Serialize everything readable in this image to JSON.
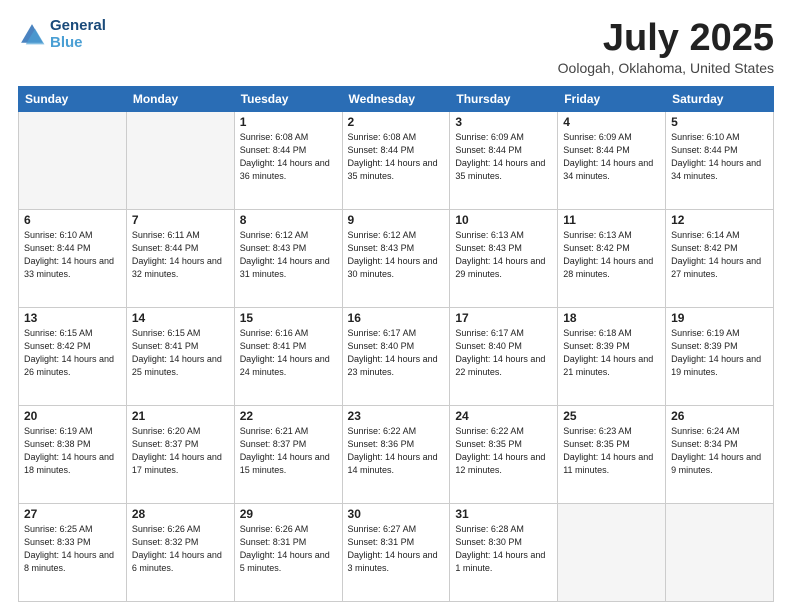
{
  "logo": {
    "line1": "General",
    "line2": "Blue"
  },
  "title": "July 2025",
  "subtitle": "Oologah, Oklahoma, United States",
  "days_of_week": [
    "Sunday",
    "Monday",
    "Tuesday",
    "Wednesday",
    "Thursday",
    "Friday",
    "Saturday"
  ],
  "weeks": [
    [
      {
        "day": "",
        "empty": true
      },
      {
        "day": "",
        "empty": true
      },
      {
        "day": "1",
        "sunrise": "6:08 AM",
        "sunset": "8:44 PM",
        "daylight": "14 hours and 36 minutes."
      },
      {
        "day": "2",
        "sunrise": "6:08 AM",
        "sunset": "8:44 PM",
        "daylight": "14 hours and 35 minutes."
      },
      {
        "day": "3",
        "sunrise": "6:09 AM",
        "sunset": "8:44 PM",
        "daylight": "14 hours and 35 minutes."
      },
      {
        "day": "4",
        "sunrise": "6:09 AM",
        "sunset": "8:44 PM",
        "daylight": "14 hours and 34 minutes."
      },
      {
        "day": "5",
        "sunrise": "6:10 AM",
        "sunset": "8:44 PM",
        "daylight": "14 hours and 34 minutes."
      }
    ],
    [
      {
        "day": "6",
        "sunrise": "6:10 AM",
        "sunset": "8:44 PM",
        "daylight": "14 hours and 33 minutes."
      },
      {
        "day": "7",
        "sunrise": "6:11 AM",
        "sunset": "8:44 PM",
        "daylight": "14 hours and 32 minutes."
      },
      {
        "day": "8",
        "sunrise": "6:12 AM",
        "sunset": "8:43 PM",
        "daylight": "14 hours and 31 minutes."
      },
      {
        "day": "9",
        "sunrise": "6:12 AM",
        "sunset": "8:43 PM",
        "daylight": "14 hours and 30 minutes."
      },
      {
        "day": "10",
        "sunrise": "6:13 AM",
        "sunset": "8:43 PM",
        "daylight": "14 hours and 29 minutes."
      },
      {
        "day": "11",
        "sunrise": "6:13 AM",
        "sunset": "8:42 PM",
        "daylight": "14 hours and 28 minutes."
      },
      {
        "day": "12",
        "sunrise": "6:14 AM",
        "sunset": "8:42 PM",
        "daylight": "14 hours and 27 minutes."
      }
    ],
    [
      {
        "day": "13",
        "sunrise": "6:15 AM",
        "sunset": "8:42 PM",
        "daylight": "14 hours and 26 minutes."
      },
      {
        "day": "14",
        "sunrise": "6:15 AM",
        "sunset": "8:41 PM",
        "daylight": "14 hours and 25 minutes."
      },
      {
        "day": "15",
        "sunrise": "6:16 AM",
        "sunset": "8:41 PM",
        "daylight": "14 hours and 24 minutes."
      },
      {
        "day": "16",
        "sunrise": "6:17 AM",
        "sunset": "8:40 PM",
        "daylight": "14 hours and 23 minutes."
      },
      {
        "day": "17",
        "sunrise": "6:17 AM",
        "sunset": "8:40 PM",
        "daylight": "14 hours and 22 minutes."
      },
      {
        "day": "18",
        "sunrise": "6:18 AM",
        "sunset": "8:39 PM",
        "daylight": "14 hours and 21 minutes."
      },
      {
        "day": "19",
        "sunrise": "6:19 AM",
        "sunset": "8:39 PM",
        "daylight": "14 hours and 19 minutes."
      }
    ],
    [
      {
        "day": "20",
        "sunrise": "6:19 AM",
        "sunset": "8:38 PM",
        "daylight": "14 hours and 18 minutes."
      },
      {
        "day": "21",
        "sunrise": "6:20 AM",
        "sunset": "8:37 PM",
        "daylight": "14 hours and 17 minutes."
      },
      {
        "day": "22",
        "sunrise": "6:21 AM",
        "sunset": "8:37 PM",
        "daylight": "14 hours and 15 minutes."
      },
      {
        "day": "23",
        "sunrise": "6:22 AM",
        "sunset": "8:36 PM",
        "daylight": "14 hours and 14 minutes."
      },
      {
        "day": "24",
        "sunrise": "6:22 AM",
        "sunset": "8:35 PM",
        "daylight": "14 hours and 12 minutes."
      },
      {
        "day": "25",
        "sunrise": "6:23 AM",
        "sunset": "8:35 PM",
        "daylight": "14 hours and 11 minutes."
      },
      {
        "day": "26",
        "sunrise": "6:24 AM",
        "sunset": "8:34 PM",
        "daylight": "14 hours and 9 minutes."
      }
    ],
    [
      {
        "day": "27",
        "sunrise": "6:25 AM",
        "sunset": "8:33 PM",
        "daylight": "14 hours and 8 minutes."
      },
      {
        "day": "28",
        "sunrise": "6:26 AM",
        "sunset": "8:32 PM",
        "daylight": "14 hours and 6 minutes."
      },
      {
        "day": "29",
        "sunrise": "6:26 AM",
        "sunset": "8:31 PM",
        "daylight": "14 hours and 5 minutes."
      },
      {
        "day": "30",
        "sunrise": "6:27 AM",
        "sunset": "8:31 PM",
        "daylight": "14 hours and 3 minutes."
      },
      {
        "day": "31",
        "sunrise": "6:28 AM",
        "sunset": "8:30 PM",
        "daylight": "14 hours and 1 minute."
      },
      {
        "day": "",
        "empty": true
      },
      {
        "day": "",
        "empty": true
      }
    ]
  ]
}
